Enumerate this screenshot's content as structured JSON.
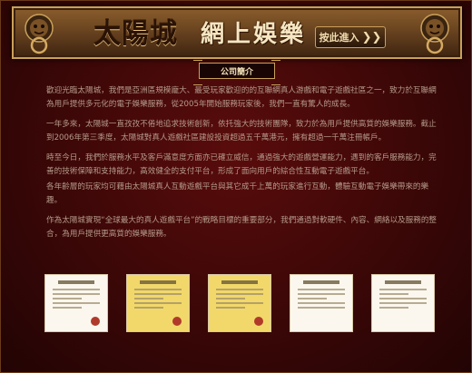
{
  "header": {
    "logo": "太陽城",
    "title": "網上娛樂",
    "enter_button": "按此進入",
    "enter_chevron": "❯❯"
  },
  "section_title": "公司簡介",
  "paragraphs": [
    "歡迎光臨太陽城，我們是亞洲區規模龐大、最受玩家歡迎的的互聯網真人游戲和電子遊戲社區之一，致力於互聯網為用戶提供多元化的電子娛樂服務，從2005年開始服務玩家後，我們一直有驚人的成長。",
    "一年多來，太陽城一直孜孜不倦地追求技術創新，依托強大的技術團隊，致力於為用戶提供高質的娛樂服務。截止到2006年第三季度，太陽城對真人遊戲社區建設投資超過五千萬港元，擁有超過一千萬注冊帳戶。",
    "時至今日，我們於服務水平及客戶滿意度方面亦已確立威信，通過強大的遊戲營運能力，遇到的客戶服務能力，完善的技術保障和支持能力，高效健全的支付平台，形成了面向用戶的綜合性互動電子遊戲平台。",
    "各年齡層的玩家均可藉由太陽城真人互動遊戲平台與其它成千上萬的玩家進行互動，體驗互動電子娛樂帶來的樂趣。",
    "作為太陽城實現“全球最大的真人遊戲平台”的戰略目標的重要部分，我們通過對軟硬件、內容、網絡以及服務的整合，為用戶提供更高質的娛樂服務。"
  ],
  "certificates": [
    {
      "name": "certificate-1",
      "style": "white"
    },
    {
      "name": "certificate-2",
      "style": "yellow"
    },
    {
      "name": "certificate-3",
      "style": "yellow"
    },
    {
      "name": "certificate-4",
      "style": "white"
    },
    {
      "name": "certificate-5",
      "style": "white"
    }
  ],
  "colors": {
    "background": "#3b0707",
    "banner_gold": "#c9a05a",
    "text": "#b49a8a"
  },
  "icons": [
    "lion-knocker-icon",
    "chevron-right-icon"
  ]
}
